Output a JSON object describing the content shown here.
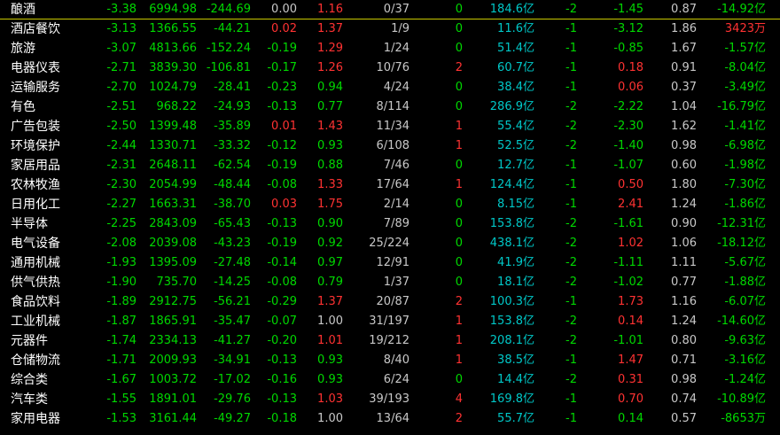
{
  "colors": {
    "up": "#ff3232",
    "down": "#00d800",
    "neutral": "#c8c8c8",
    "amount": "#00c8c8",
    "background": "#000000",
    "selection": "#c8c800"
  },
  "rows": [
    {
      "name": "酿酒",
      "chg": "-3.38",
      "price": "6994.98",
      "diff": "-244.69",
      "speed": "0.00",
      "ratio": "1.16",
      "updown": "0/37",
      "lead": "0",
      "amount": "184.6亿",
      "c9": "-2",
      "c10": "-1.45",
      "c11": "0.87",
      "flow": "-14.92亿",
      "speed_c": "neutral",
      "ratio_c": "up",
      "lead_c": "down",
      "c10_c": "down",
      "flow_c": "down"
    },
    {
      "name": "酒店餐饮",
      "chg": "-3.13",
      "price": "1366.55",
      "diff": "-44.21",
      "speed": "0.02",
      "ratio": "1.37",
      "updown": "1/9",
      "lead": "0",
      "amount": "11.6亿",
      "c9": "-1",
      "c10": "-3.12",
      "c11": "1.86",
      "flow": "3423万",
      "speed_c": "up",
      "ratio_c": "up",
      "lead_c": "down",
      "c10_c": "down",
      "flow_c": "up"
    },
    {
      "name": "旅游",
      "chg": "-3.07",
      "price": "4813.66",
      "diff": "-152.24",
      "speed": "-0.19",
      "ratio": "1.29",
      "updown": "1/24",
      "lead": "0",
      "amount": "51.4亿",
      "c9": "-1",
      "c10": "-0.85",
      "c11": "1.67",
      "flow": "-1.57亿",
      "speed_c": "down",
      "ratio_c": "up",
      "lead_c": "down",
      "c10_c": "down",
      "flow_c": "down"
    },
    {
      "name": "电器仪表",
      "chg": "-2.71",
      "price": "3839.30",
      "diff": "-106.81",
      "speed": "-0.17",
      "ratio": "1.26",
      "updown": "10/76",
      "lead": "2",
      "amount": "60.7亿",
      "c9": "-1",
      "c10": "0.18",
      "c11": "0.91",
      "flow": "-8.04亿",
      "speed_c": "down",
      "ratio_c": "up",
      "lead_c": "up",
      "c10_c": "up",
      "flow_c": "down"
    },
    {
      "name": "运输服务",
      "chg": "-2.70",
      "price": "1024.79",
      "diff": "-28.41",
      "speed": "-0.23",
      "ratio": "0.94",
      "updown": "4/24",
      "lead": "0",
      "amount": "38.4亿",
      "c9": "-1",
      "c10": "0.06",
      "c11": "0.37",
      "flow": "-3.49亿",
      "speed_c": "down",
      "ratio_c": "down",
      "lead_c": "down",
      "c10_c": "up",
      "flow_c": "down"
    },
    {
      "name": "有色",
      "chg": "-2.51",
      "price": "968.22",
      "diff": "-24.93",
      "speed": "-0.13",
      "ratio": "0.77",
      "updown": "8/114",
      "lead": "0",
      "amount": "286.9亿",
      "c9": "-2",
      "c10": "-2.22",
      "c11": "1.04",
      "flow": "-16.79亿",
      "speed_c": "down",
      "ratio_c": "down",
      "lead_c": "down",
      "c10_c": "down",
      "flow_c": "down"
    },
    {
      "name": "广告包装",
      "chg": "-2.50",
      "price": "1399.48",
      "diff": "-35.89",
      "speed": "0.01",
      "ratio": "1.43",
      "updown": "11/34",
      "lead": "1",
      "amount": "55.4亿",
      "c9": "-2",
      "c10": "-2.30",
      "c11": "1.62",
      "flow": "-1.41亿",
      "speed_c": "up",
      "ratio_c": "up",
      "lead_c": "up",
      "c10_c": "down",
      "flow_c": "down"
    },
    {
      "name": "环境保护",
      "chg": "-2.44",
      "price": "1330.71",
      "diff": "-33.32",
      "speed": "-0.12",
      "ratio": "0.93",
      "updown": "6/108",
      "lead": "1",
      "amount": "52.5亿",
      "c9": "-2",
      "c10": "-1.40",
      "c11": "0.98",
      "flow": "-6.98亿",
      "speed_c": "down",
      "ratio_c": "down",
      "lead_c": "up",
      "c10_c": "down",
      "flow_c": "down"
    },
    {
      "name": "家居用品",
      "chg": "-2.31",
      "price": "2648.11",
      "diff": "-62.54",
      "speed": "-0.19",
      "ratio": "0.88",
      "updown": "7/46",
      "lead": "0",
      "amount": "12.7亿",
      "c9": "-1",
      "c10": "-1.07",
      "c11": "0.60",
      "flow": "-1.98亿",
      "speed_c": "down",
      "ratio_c": "down",
      "lead_c": "down",
      "c10_c": "down",
      "flow_c": "down"
    },
    {
      "name": "农林牧渔",
      "chg": "-2.30",
      "price": "2054.99",
      "diff": "-48.44",
      "speed": "-0.08",
      "ratio": "1.33",
      "updown": "17/64",
      "lead": "1",
      "amount": "124.4亿",
      "c9": "-1",
      "c10": "0.50",
      "c11": "1.80",
      "flow": "-7.30亿",
      "speed_c": "down",
      "ratio_c": "up",
      "lead_c": "up",
      "c10_c": "up",
      "flow_c": "down"
    },
    {
      "name": "日用化工",
      "chg": "-2.27",
      "price": "1663.31",
      "diff": "-38.70",
      "speed": "0.03",
      "ratio": "1.75",
      "updown": "2/14",
      "lead": "0",
      "amount": "8.15亿",
      "c9": "-1",
      "c10": "2.41",
      "c11": "1.24",
      "flow": "-1.86亿",
      "speed_c": "up",
      "ratio_c": "up",
      "lead_c": "down",
      "c10_c": "up",
      "flow_c": "down"
    },
    {
      "name": "半导体",
      "chg": "-2.25",
      "price": "2843.09",
      "diff": "-65.43",
      "speed": "-0.13",
      "ratio": "0.90",
      "updown": "7/89",
      "lead": "0",
      "amount": "153.8亿",
      "c9": "-2",
      "c10": "-1.61",
      "c11": "0.90",
      "flow": "-12.31亿",
      "speed_c": "down",
      "ratio_c": "down",
      "lead_c": "down",
      "c10_c": "down",
      "flow_c": "down"
    },
    {
      "name": "电气设备",
      "chg": "-2.08",
      "price": "2039.08",
      "diff": "-43.23",
      "speed": "-0.19",
      "ratio": "0.92",
      "updown": "25/224",
      "lead": "0",
      "amount": "438.1亿",
      "c9": "-2",
      "c10": "1.02",
      "c11": "1.06",
      "flow": "-18.12亿",
      "speed_c": "down",
      "ratio_c": "down",
      "lead_c": "down",
      "c10_c": "up",
      "flow_c": "down"
    },
    {
      "name": "通用机械",
      "chg": "-1.93",
      "price": "1395.09",
      "diff": "-27.48",
      "speed": "-0.14",
      "ratio": "0.97",
      "updown": "12/91",
      "lead": "0",
      "amount": "41.9亿",
      "c9": "-2",
      "c10": "-1.11",
      "c11": "1.11",
      "flow": "-5.67亿",
      "speed_c": "down",
      "ratio_c": "down",
      "lead_c": "down",
      "c10_c": "down",
      "flow_c": "down"
    },
    {
      "name": "供气供热",
      "chg": "-1.90",
      "price": "735.70",
      "diff": "-14.25",
      "speed": "-0.08",
      "ratio": "0.79",
      "updown": "1/37",
      "lead": "0",
      "amount": "18.1亿",
      "c9": "-2",
      "c10": "-1.02",
      "c11": "0.77",
      "flow": "-1.88亿",
      "speed_c": "down",
      "ratio_c": "down",
      "lead_c": "down",
      "c10_c": "down",
      "flow_c": "down"
    },
    {
      "name": "食品饮料",
      "chg": "-1.89",
      "price": "2912.75",
      "diff": "-56.21",
      "speed": "-0.29",
      "ratio": "1.37",
      "updown": "20/87",
      "lead": "2",
      "amount": "100.3亿",
      "c9": "-1",
      "c10": "1.73",
      "c11": "1.16",
      "flow": "-6.07亿",
      "speed_c": "down",
      "ratio_c": "up",
      "lead_c": "up",
      "c10_c": "up",
      "flow_c": "down"
    },
    {
      "name": "工业机械",
      "chg": "-1.87",
      "price": "1865.91",
      "diff": "-35.47",
      "speed": "-0.07",
      "ratio": "1.00",
      "updown": "31/197",
      "lead": "1",
      "amount": "153.8亿",
      "c9": "-2",
      "c10": "0.14",
      "c11": "1.24",
      "flow": "-14.60亿",
      "speed_c": "down",
      "ratio_c": "neutral",
      "lead_c": "up",
      "c10_c": "up",
      "flow_c": "down"
    },
    {
      "name": "元器件",
      "chg": "-1.74",
      "price": "2334.13",
      "diff": "-41.27",
      "speed": "-0.20",
      "ratio": "1.01",
      "updown": "19/212",
      "lead": "1",
      "amount": "208.1亿",
      "c9": "-2",
      "c10": "-1.01",
      "c11": "0.80",
      "flow": "-9.63亿",
      "speed_c": "down",
      "ratio_c": "up",
      "lead_c": "up",
      "c10_c": "down",
      "flow_c": "down"
    },
    {
      "name": "仓储物流",
      "chg": "-1.71",
      "price": "2009.93",
      "diff": "-34.91",
      "speed": "-0.13",
      "ratio": "0.93",
      "updown": "8/40",
      "lead": "1",
      "amount": "38.5亿",
      "c9": "-1",
      "c10": "1.47",
      "c11": "0.71",
      "flow": "-3.16亿",
      "speed_c": "down",
      "ratio_c": "down",
      "lead_c": "up",
      "c10_c": "up",
      "flow_c": "down"
    },
    {
      "name": "综合类",
      "chg": "-1.67",
      "price": "1003.72",
      "diff": "-17.02",
      "speed": "-0.16",
      "ratio": "0.93",
      "updown": "6/24",
      "lead": "0",
      "amount": "14.4亿",
      "c9": "-2",
      "c10": "0.31",
      "c11": "0.98",
      "flow": "-1.24亿",
      "speed_c": "down",
      "ratio_c": "down",
      "lead_c": "down",
      "c10_c": "up",
      "flow_c": "down"
    },
    {
      "name": "汽车类",
      "chg": "-1.55",
      "price": "1891.01",
      "diff": "-29.76",
      "speed": "-0.13",
      "ratio": "1.03",
      "updown": "39/193",
      "lead": "4",
      "amount": "169.8亿",
      "c9": "-1",
      "c10": "0.70",
      "c11": "0.74",
      "flow": "-10.89亿",
      "speed_c": "down",
      "ratio_c": "up",
      "lead_c": "up",
      "c10_c": "up",
      "flow_c": "down"
    },
    {
      "name": "家用电器",
      "chg": "-1.53",
      "price": "3161.44",
      "diff": "-49.27",
      "speed": "-0.18",
      "ratio": "1.00",
      "updown": "13/64",
      "lead": "2",
      "amount": "55.7亿",
      "c9": "-1",
      "c10": "0.14",
      "c11": "0.57",
      "flow": "-8653万",
      "speed_c": "down",
      "ratio_c": "neutral",
      "lead_c": "up",
      "c10_c": "down",
      "flow_c": "down"
    }
  ]
}
